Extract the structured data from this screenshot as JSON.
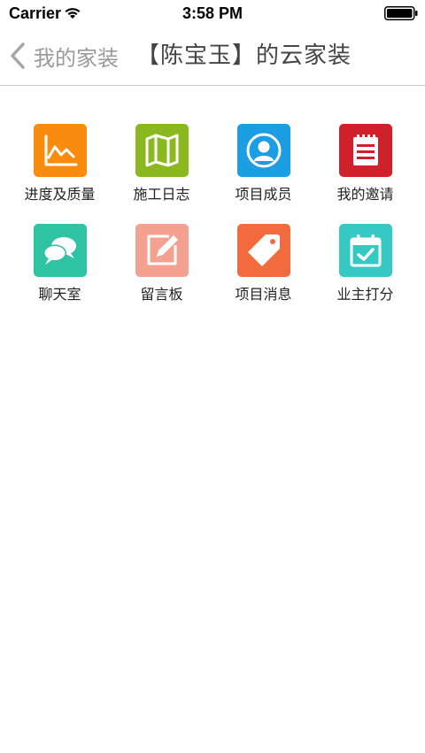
{
  "status_bar": {
    "carrier": "Carrier",
    "time": "3:58 PM"
  },
  "navbar": {
    "back_label": "我的家装",
    "title": "【陈宝玉】的云家装"
  },
  "menu": [
    {
      "label": "进度及质量",
      "icon": "chart-line-icon",
      "color": "#f98c0f"
    },
    {
      "label": "施工日志",
      "icon": "map-icon",
      "color": "#8cb81f"
    },
    {
      "label": "项目成员",
      "icon": "user-icon",
      "color": "#1b9ee2"
    },
    {
      "label": "我的邀请",
      "icon": "notepad-icon",
      "color": "#d0212a"
    },
    {
      "label": "聊天室",
      "icon": "chat-bubbles-icon",
      "color": "#2ec3a3"
    },
    {
      "label": "留言板",
      "icon": "edit-note-icon",
      "color": "#f4a191"
    },
    {
      "label": "项目消息",
      "icon": "tag-icon",
      "color": "#f26b3f"
    },
    {
      "label": "业主打分",
      "icon": "calendar-check-icon",
      "color": "#36c9c4"
    }
  ]
}
